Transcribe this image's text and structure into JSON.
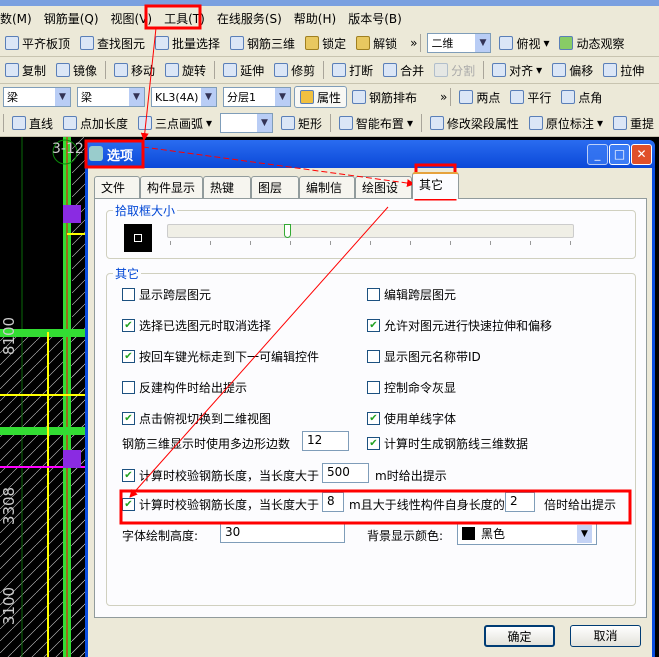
{
  "menu": [
    "数(M)",
    "钢筋量(Q)",
    "视图(V)",
    "工具(T)",
    "在线服务(S)",
    "帮助(H)",
    "版本号(B)"
  ],
  "toolbar1": [
    "平齐板顶",
    "查找图元",
    "批量选择",
    "钢筋三维",
    "锁定",
    "解锁"
  ],
  "toolbar1_right": {
    "view_mode": "二维",
    "view_dir": "俯视",
    "dynamic": "动态观察"
  },
  "toolbar2": [
    "复制",
    "镜像",
    "移动",
    "旋转",
    "延伸",
    "修剪",
    "打断",
    "合并",
    "分割",
    "对齐",
    "偏移",
    "拉伸"
  ],
  "toolbar3": {
    "selects": [
      "梁",
      "梁",
      "KL3(4A)",
      "分层1"
    ],
    "property": "属性",
    "rebar_layout": "钢筋排布",
    "right": [
      "两点",
      "平行",
      "点角"
    ]
  },
  "toolbar4": [
    "直线",
    "点加长度",
    "三点画弧",
    "",
    "矩形",
    "智能布置",
    "修改梁段属性",
    "原位标注",
    "重提"
  ],
  "canvas_labels": [
    "3-12",
    "8100",
    "3308",
    "3100"
  ],
  "dialog": {
    "title": "选项",
    "tabs": [
      "文件",
      "构件显示",
      "热键",
      "图层",
      "编制信息",
      "绘图设置",
      "其它"
    ],
    "active_tab": "其它",
    "pick_box": {
      "label": "拾取框大小",
      "slider_value": 3,
      "slider_max": 10
    },
    "other": {
      "label": "其它",
      "left": [
        {
          "text": "显示跨层图元",
          "checked": false
        },
        {
          "text": "选择已选图元时取消选择",
          "checked": true
        },
        {
          "text": "按回车键光标走到下一可编辑控件",
          "checked": true
        },
        {
          "text": "反建构件时给出提示",
          "checked": false
        },
        {
          "text": "点击俯视切换到二维视图",
          "checked": true
        }
      ],
      "right": [
        {
          "text": "编辑跨层图元",
          "checked": false
        },
        {
          "text": "允许对图元进行快速拉伸和偏移",
          "checked": true
        },
        {
          "text": "显示图元名称带ID",
          "checked": false
        },
        {
          "text": "控制命令灰显",
          "checked": false
        },
        {
          "text": "使用单线字体",
          "checked": true
        }
      ],
      "polygon_label": "钢筋三维显示时使用多边形边数",
      "polygon_value": "12",
      "gen3d": {
        "text": "计算时生成钢筋线三维数据",
        "checked": true
      },
      "check1": {
        "text": "计算时校验钢筋长度，当长度大于",
        "value": "500",
        "suffix": "m时给出提示",
        "checked": true
      },
      "check2": {
        "text": "计算时校验钢筋长度，当长度大于",
        "value": "8",
        "mid": "m且大于线性构件自身长度的",
        "value2": "2",
        "suffix": "倍时给出提示",
        "checked": true
      },
      "font_height_label": "字体绘制高度:",
      "font_height": "30",
      "bg_color_label": "背景显示颜色:",
      "bg_color": "黑色"
    },
    "ok": "确定",
    "cancel": "取消"
  },
  "colors": {
    "highlight": "#ff0000",
    "title": "#0a4ee0"
  }
}
